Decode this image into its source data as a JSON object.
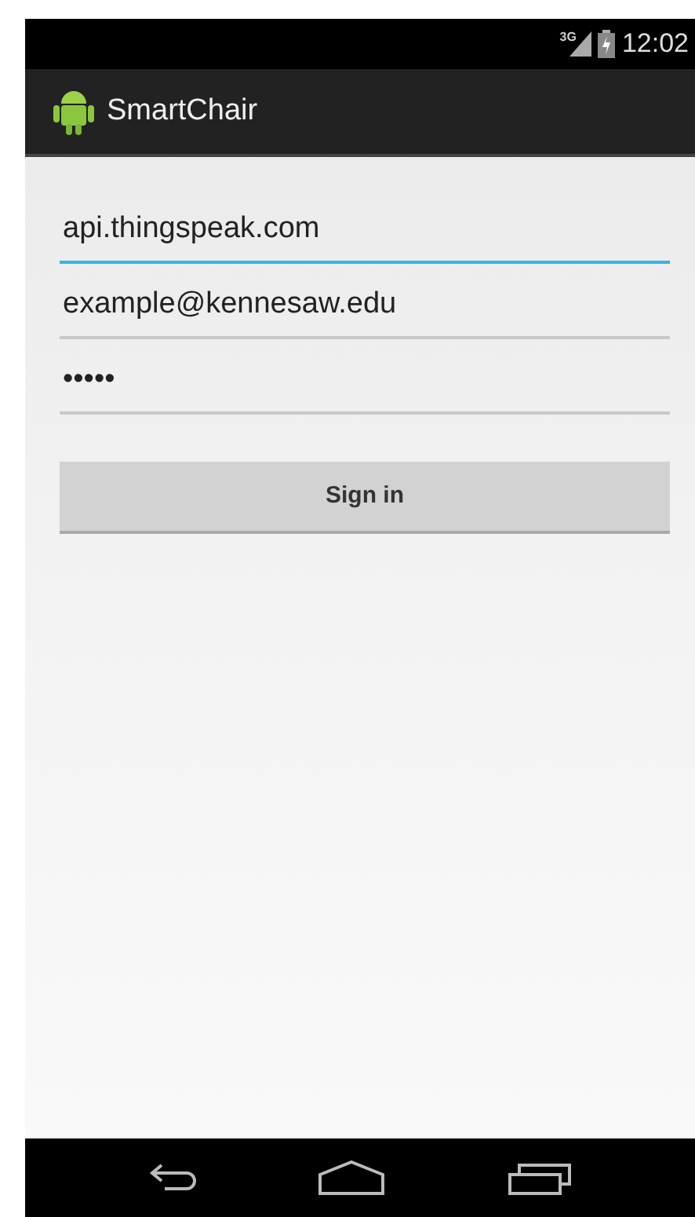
{
  "status_bar": {
    "network": "3G",
    "time": "12:02"
  },
  "action_bar": {
    "title": "SmartChair"
  },
  "fields": [
    {
      "value": "api.thingspeak.com",
      "focused": true
    },
    {
      "value": "example@kennesaw.edu",
      "focused": false
    },
    {
      "value": "•••••",
      "focused": false
    }
  ],
  "button": {
    "label": "Sign in"
  }
}
